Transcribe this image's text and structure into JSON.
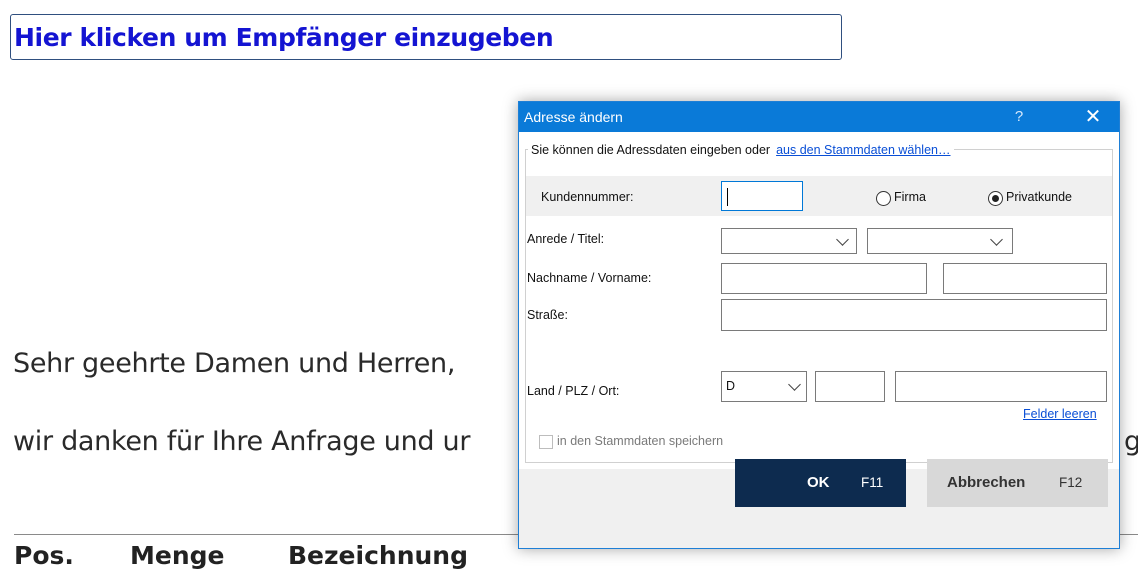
{
  "document": {
    "recipient_placeholder": "Hier klicken um Empfänger einzugeben",
    "salutation": "Sehr geehrte Damen und Herren,",
    "body_line": "wir danken für Ihre Anfrage und ur",
    "body_line_tail": "g",
    "table_headers": [
      "Pos.",
      "Menge",
      "Bezeichnung"
    ]
  },
  "dialog": {
    "title": "Adresse ändern",
    "help_symbol": "?",
    "close_symbol": "✕",
    "group_text": "Sie können die Adressdaten eingeben oder",
    "group_link": "aus den Stammdaten wählen…",
    "fields": {
      "kundennummer_label": "Kundennummer:",
      "kundennummer_value": "",
      "radio_firma_label": "Firma",
      "radio_privat_label": "Privatkunde",
      "selected_customer_type": "Privatkunde",
      "anrede_label": "Anrede / Titel:",
      "anrede_value": "",
      "titel_value": "",
      "name_label": "Nachname / Vorname:",
      "nachname_value": "",
      "vorname_value": "",
      "strasse_label": "Straße:",
      "strasse_value": "",
      "land_label": "Land / PLZ / Ort:",
      "land_value": "D",
      "plz_value": "",
      "ort_value": ""
    },
    "clear_fields_link": "Felder leeren",
    "save_checkbox_label": "in den Stammdaten speichern",
    "save_checkbox_checked": false,
    "ok_button": {
      "label": "OK",
      "shortcut": "F11"
    },
    "cancel_button": {
      "label": "Abbrechen",
      "shortcut": "F12"
    },
    "colors": {
      "titlebar": "#0a7ad8",
      "ok_button": "#0d2b4f",
      "link": "#0a4fd6",
      "recipient_text": "#1414d2"
    }
  }
}
